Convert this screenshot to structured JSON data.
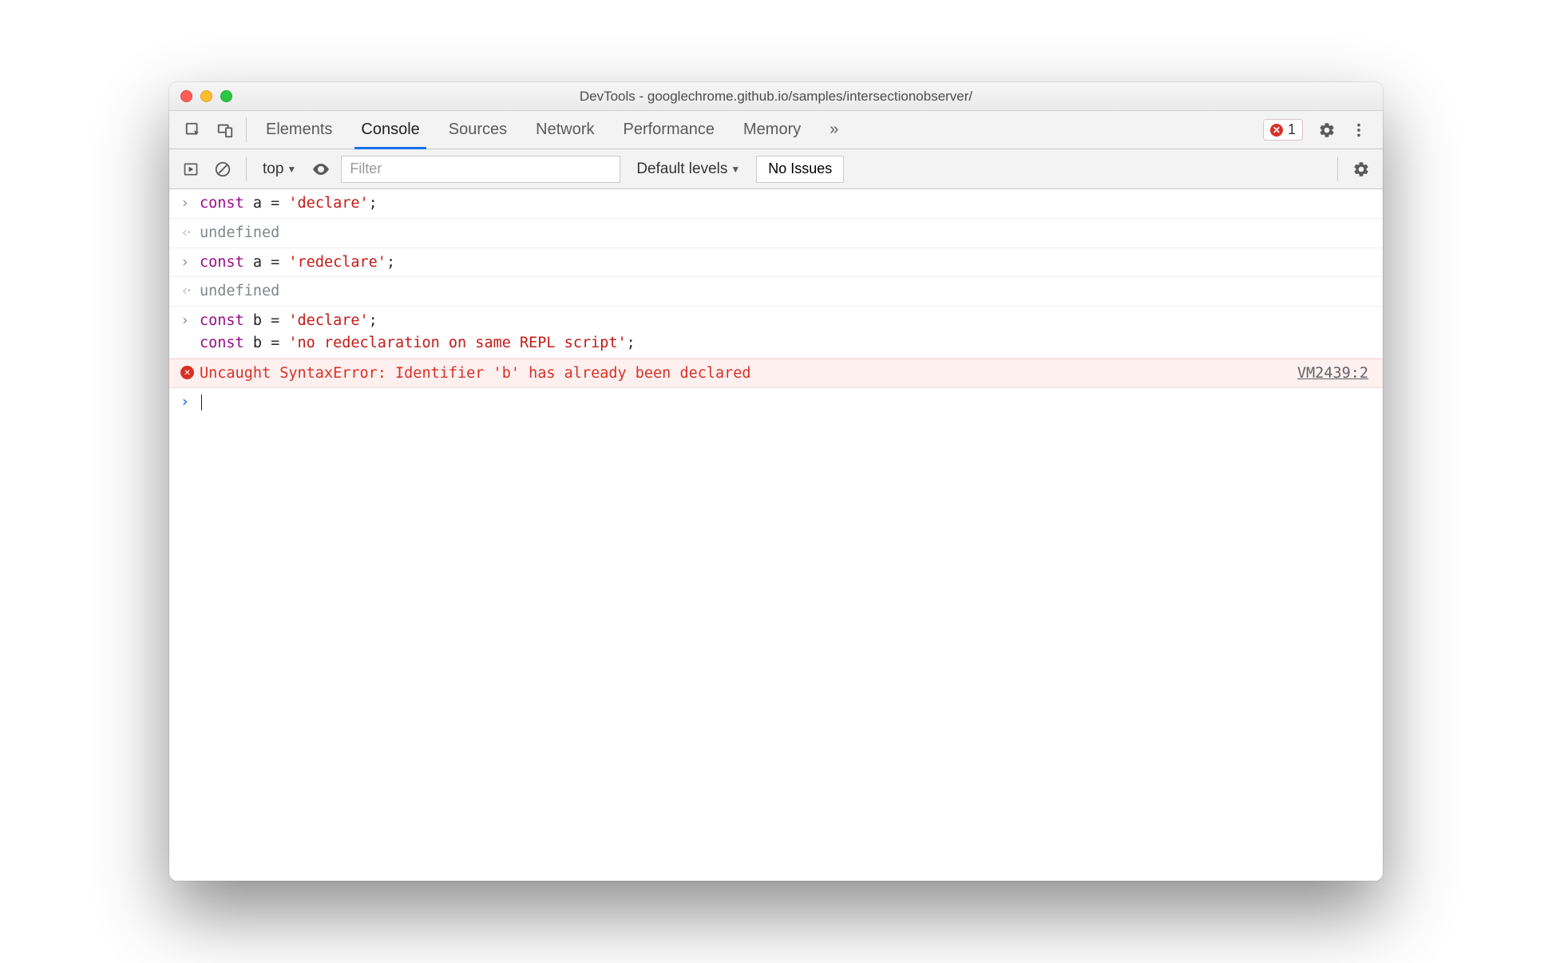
{
  "window": {
    "title": "DevTools - googlechrome.github.io/samples/intersectionobserver/"
  },
  "tabs": {
    "items": [
      "Elements",
      "Console",
      "Sources",
      "Network",
      "Performance",
      "Memory"
    ],
    "active_index": 1,
    "overflow_glyph": "»",
    "error_count": "1"
  },
  "toolbar": {
    "context": "top",
    "filter_placeholder": "Filter",
    "levels_label": "Default levels",
    "issues_label": "No Issues"
  },
  "console": {
    "entries": [
      {
        "type": "input",
        "segments": [
          {
            "t": "kw",
            "v": "const"
          },
          {
            "t": "sp",
            "v": " "
          },
          {
            "t": "id",
            "v": "a"
          },
          {
            "t": "sp",
            "v": " "
          },
          {
            "t": "op",
            "v": "="
          },
          {
            "t": "sp",
            "v": " "
          },
          {
            "t": "str",
            "v": "'declare'"
          },
          {
            "t": "op",
            "v": ";"
          }
        ]
      },
      {
        "type": "output",
        "text": "undefined"
      },
      {
        "type": "input",
        "segments": [
          {
            "t": "kw",
            "v": "const"
          },
          {
            "t": "sp",
            "v": " "
          },
          {
            "t": "id",
            "v": "a"
          },
          {
            "t": "sp",
            "v": " "
          },
          {
            "t": "op",
            "v": "="
          },
          {
            "t": "sp",
            "v": " "
          },
          {
            "t": "str",
            "v": "'redeclare'"
          },
          {
            "t": "op",
            "v": ";"
          }
        ]
      },
      {
        "type": "output",
        "text": "undefined"
      },
      {
        "type": "input",
        "segments": [
          {
            "t": "kw",
            "v": "const"
          },
          {
            "t": "sp",
            "v": " "
          },
          {
            "t": "id",
            "v": "b"
          },
          {
            "t": "sp",
            "v": " "
          },
          {
            "t": "op",
            "v": "="
          },
          {
            "t": "sp",
            "v": " "
          },
          {
            "t": "str",
            "v": "'declare'"
          },
          {
            "t": "op",
            "v": ";"
          },
          {
            "t": "nl",
            "v": "\n"
          },
          {
            "t": "kw",
            "v": "const"
          },
          {
            "t": "sp",
            "v": " "
          },
          {
            "t": "id",
            "v": "b"
          },
          {
            "t": "sp",
            "v": " "
          },
          {
            "t": "op",
            "v": "="
          },
          {
            "t": "sp",
            "v": " "
          },
          {
            "t": "str",
            "v": "'no redeclaration on same REPL script'"
          },
          {
            "t": "op",
            "v": ";"
          }
        ]
      },
      {
        "type": "error",
        "text": "Uncaught SyntaxError: Identifier 'b' has already been declared",
        "source": "VM2439:2"
      },
      {
        "type": "prompt"
      }
    ]
  }
}
